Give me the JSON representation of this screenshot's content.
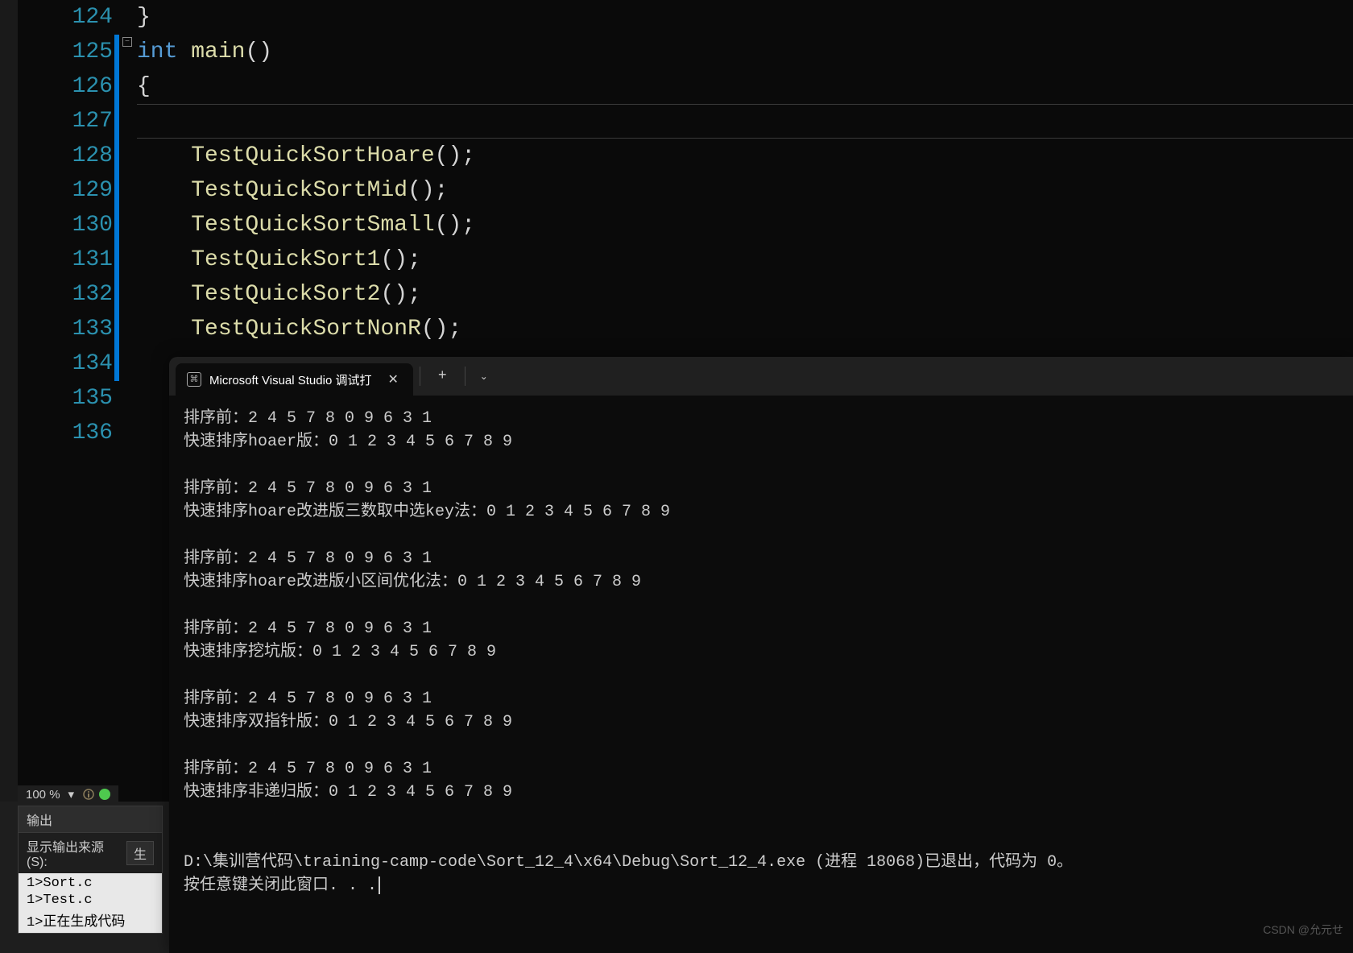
{
  "editor": {
    "line_numbers": [
      "124",
      "125",
      "126",
      "127",
      "128",
      "129",
      "130",
      "131",
      "132",
      "133",
      "134",
      "135",
      "136"
    ],
    "lines": [
      {
        "indent": 0,
        "tokens": [
          {
            "t": "brace",
            "v": "}"
          }
        ]
      },
      {
        "indent": 0,
        "tokens": [
          {
            "t": "kw",
            "v": "int"
          },
          {
            "t": "punct",
            "v": " "
          },
          {
            "t": "fn",
            "v": "main"
          },
          {
            "t": "punct",
            "v": "()"
          }
        ]
      },
      {
        "indent": 0,
        "tokens": [
          {
            "t": "brace",
            "v": "{"
          }
        ]
      },
      {
        "indent": 1,
        "tokens": [],
        "current": true
      },
      {
        "indent": 1,
        "tokens": [
          {
            "t": "fn",
            "v": "TestQuickSortHoare"
          },
          {
            "t": "punct",
            "v": "();"
          }
        ]
      },
      {
        "indent": 1,
        "tokens": [
          {
            "t": "fn",
            "v": "TestQuickSortMid"
          },
          {
            "t": "punct",
            "v": "();"
          }
        ]
      },
      {
        "indent": 1,
        "tokens": [
          {
            "t": "fn",
            "v": "TestQuickSortSmall"
          },
          {
            "t": "punct",
            "v": "();"
          }
        ]
      },
      {
        "indent": 1,
        "tokens": [
          {
            "t": "fn",
            "v": "TestQuickSort1"
          },
          {
            "t": "punct",
            "v": "();"
          }
        ]
      },
      {
        "indent": 1,
        "tokens": [
          {
            "t": "fn",
            "v": "TestQuickSort2"
          },
          {
            "t": "punct",
            "v": "();"
          }
        ]
      },
      {
        "indent": 1,
        "tokens": [
          {
            "t": "fn",
            "v": "TestQuickSortNonR"
          },
          {
            "t": "punct",
            "v": "();"
          }
        ]
      },
      {
        "indent": 0,
        "tokens": []
      },
      {
        "indent": 0,
        "tokens": []
      },
      {
        "indent": 0,
        "tokens": []
      }
    ],
    "change_marker_lines": [
      1,
      2,
      3,
      4,
      5,
      6,
      7,
      8,
      9,
      10
    ]
  },
  "zoom": {
    "level": "100 %",
    "caret": "▾"
  },
  "output": {
    "panel_title": "输出",
    "source_label": "显示输出来源(S):",
    "source_value": "生",
    "lines": [
      "1>Sort.c",
      "1>Test.c",
      "1>正在生成代码"
    ]
  },
  "terminal": {
    "tab_title": "Microsoft Visual Studio 调试打",
    "lines": [
      "排序前：2 4 5 7 8 0 9 6 3 1",
      "快速排序hoaer版：0 1 2 3 4 5 6 7 8 9",
      "",
      "排序前：2 4 5 7 8 0 9 6 3 1",
      "快速排序hoare改进版三数取中选key法：0 1 2 3 4 5 6 7 8 9",
      "",
      "排序前：2 4 5 7 8 0 9 6 3 1",
      "快速排序hoare改进版小区间优化法：0 1 2 3 4 5 6 7 8 9",
      "",
      "排序前：2 4 5 7 8 0 9 6 3 1",
      "快速排序挖坑版：0 1 2 3 4 5 6 7 8 9",
      "",
      "排序前：2 4 5 7 8 0 9 6 3 1",
      "快速排序双指针版：0 1 2 3 4 5 6 7 8 9",
      "",
      "排序前：2 4 5 7 8 0 9 6 3 1",
      "快速排序非递归版：0 1 2 3 4 5 6 7 8 9",
      "",
      "",
      "D:\\集训营代码\\training-camp-code\\Sort_12_4\\x64\\Debug\\Sort_12_4.exe (进程 18068)已退出，代码为 0。",
      "按任意键关闭此窗口. . ."
    ]
  },
  "watermark": "CSDN @允元せ"
}
